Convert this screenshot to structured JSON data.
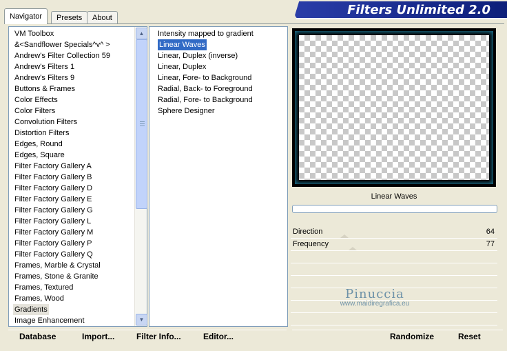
{
  "tabs": [
    "Navigator",
    "Presets",
    "About"
  ],
  "logo_text": "Filters Unlimited 2.0",
  "categories": [
    "VM Toolbox",
    "&<Sandflower Specials^v^ >",
    "Andrew's Filter Collection 59",
    "Andrew's Filters 1",
    "Andrew's Filters 9",
    "Buttons & Frames",
    "Color Effects",
    "Color Filters",
    "Convolution Filters",
    "Distortion Filters",
    "Edges, Round",
    "Edges, Square",
    "Filter Factory Gallery A",
    "Filter Factory Gallery B",
    "Filter Factory Gallery D",
    "Filter Factory Gallery E",
    "Filter Factory Gallery G",
    "Filter Factory Gallery L",
    "Filter Factory Gallery M",
    "Filter Factory Gallery P",
    "Filter Factory Gallery Q",
    "Frames, Marble & Crystal",
    "Frames, Stone & Granite",
    "Frames, Textured",
    "Frames, Wood",
    "Gradients",
    "Image Enhancement"
  ],
  "selected_category": "Gradients",
  "filters": [
    "Intensity mapped to gradient",
    "Linear Waves",
    "Linear, Duplex (inverse)",
    "Linear, Duplex",
    "Linear, Fore- to Background",
    "Radial, Back- to Foreground",
    "Radial, Fore- to Background",
    "Sphere Designer"
  ],
  "selected_filter": "Linear Waves",
  "preview": {
    "effect_name": "Linear Waves"
  },
  "params": [
    {
      "label": "Direction",
      "value": "64"
    },
    {
      "label": "Frequency",
      "value": "77"
    }
  ],
  "watermark": {
    "name": "Pinuccia",
    "url": "www.maidiregrafica.eu"
  },
  "buttons": {
    "database": "Database",
    "import": "Import...",
    "filter_info": "Filter Info...",
    "editor": "Editor...",
    "randomize": "Randomize",
    "reset": "Reset"
  },
  "colors": {
    "selection": "#316ac5",
    "logo": "#1a2f96"
  }
}
